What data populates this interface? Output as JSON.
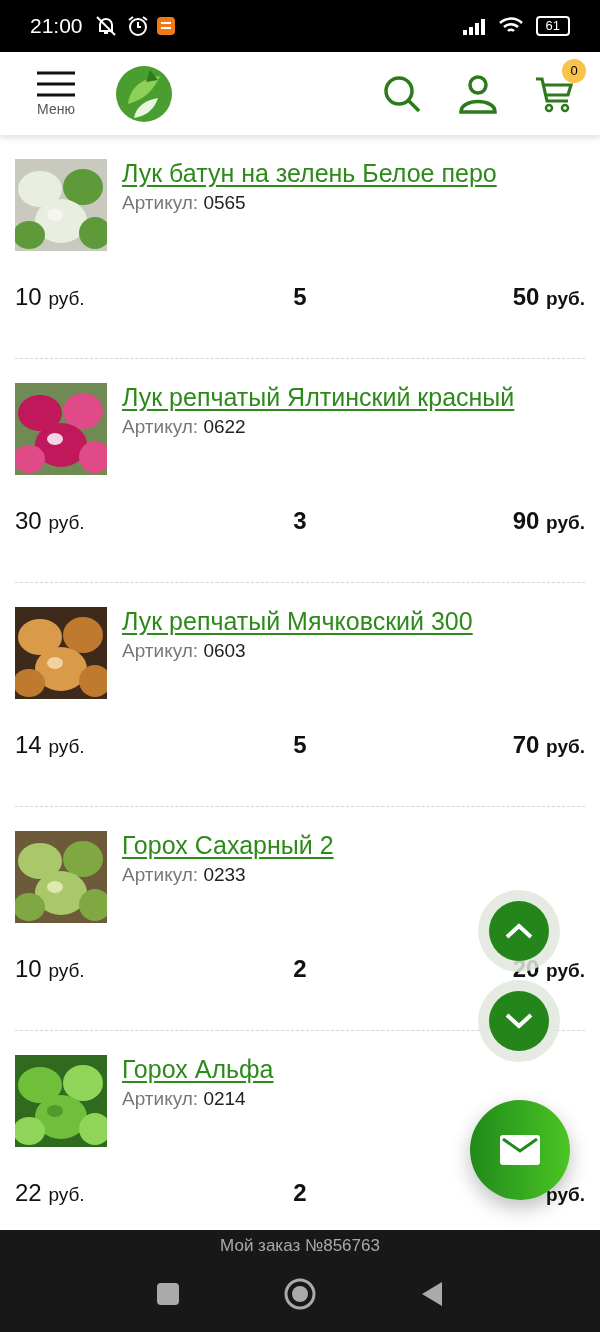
{
  "status_bar": {
    "time": "21:00",
    "battery": "61"
  },
  "header": {
    "menu_label": "Меню",
    "cart_count": "0"
  },
  "items": [
    {
      "title": "Лук батун на зелень Белое перо",
      "article_label": "Артикул:",
      "article": "0565",
      "price": "10",
      "price_unit": "руб.",
      "quantity": "5",
      "total": "50",
      "total_unit": "руб."
    },
    {
      "title": "Лук репчатый Ялтинский красный",
      "article_label": "Артикул:",
      "article": "0622",
      "price": "30",
      "price_unit": "руб.",
      "quantity": "3",
      "total": "90",
      "total_unit": "руб."
    },
    {
      "title": "Лук репчатый Мячковский 300",
      "article_label": "Артикул:",
      "article": "0603",
      "price": "14",
      "price_unit": "руб.",
      "quantity": "5",
      "total": "70",
      "total_unit": "руб."
    },
    {
      "title": "Горох Сахарный 2",
      "article_label": "Артикул:",
      "article": "0233",
      "price": "10",
      "price_unit": "руб.",
      "quantity": "2",
      "total": "20",
      "total_unit": "руб."
    },
    {
      "title": "Горох Альфа",
      "article_label": "Артикул:",
      "article": "0214",
      "price": "22",
      "price_unit": "руб.",
      "quantity": "2",
      "total_unit": "руб."
    }
  ],
  "order_bar": {
    "label": "Мой заказ №856763"
  }
}
